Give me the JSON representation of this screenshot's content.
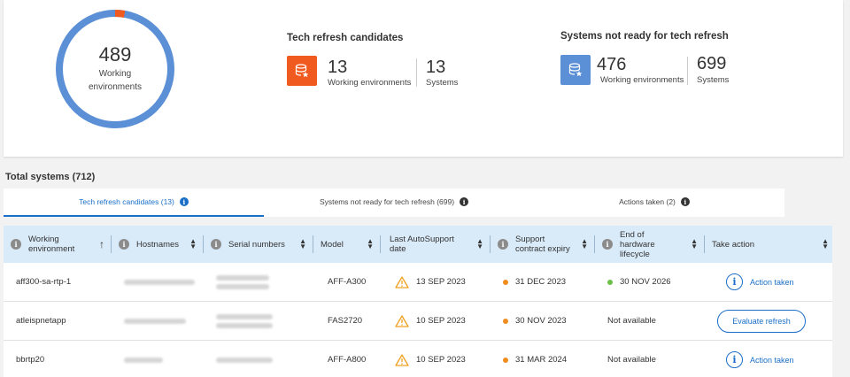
{
  "summary": {
    "total_working_envs": "489",
    "total_label_line1": "Working",
    "total_label_line2": "environments",
    "donut_fraction_candidates": 0.027,
    "candidates": {
      "title": "Tech refresh candidates",
      "we_count": "13",
      "we_label": "Working environments",
      "systems_count": "13",
      "systems_label": "Systems",
      "color": "#f15a1f"
    },
    "not_ready": {
      "title": "Systems not ready for tech refresh",
      "we_count": "476",
      "we_label": "Working environments",
      "systems_count": "699",
      "systems_label": "Systems",
      "color": "#5b8fd6"
    }
  },
  "total_systems_label": "Total systems (712)",
  "tabs": [
    {
      "label": "Tech refresh candidates (13)",
      "active": true
    },
    {
      "label": "Systems not ready for tech refresh (699)",
      "active": false
    },
    {
      "label": "Actions taken (2)",
      "active": false
    }
  ],
  "table": {
    "columns": [
      {
        "line1": "Working",
        "line2": "environment"
      },
      {
        "line1": "Hostnames",
        "line2": ""
      },
      {
        "line1": "Serial numbers",
        "line2": ""
      },
      {
        "line1": "Model",
        "line2": ""
      },
      {
        "line1": "Last AutoSupport",
        "line2": "date"
      },
      {
        "line1": "Support",
        "line2": "contract expiry"
      },
      {
        "line1": "End of",
        "line2": "hardware",
        "line3": "lifecycle"
      },
      {
        "line1": "Take action",
        "line2": ""
      }
    ],
    "rows": [
      {
        "we": "aff300-sa-rtp-1",
        "model": "AFF-A300",
        "asup": "13 SEP 2023",
        "contract": "31 DEC 2023",
        "eol": "30 NOV 2026",
        "eol_dot": true,
        "action": "Action taken",
        "action_type": "taken"
      },
      {
        "we": "atleispnetapp",
        "model": "FAS2720",
        "asup": "10 SEP 2023",
        "contract": "30 NOV 2023",
        "eol": "Not available",
        "eol_dot": false,
        "action": "Evaluate refresh",
        "action_type": "button"
      },
      {
        "we": "bbrtp20",
        "model": "AFF-A800",
        "asup": "10 SEP 2023",
        "contract": "31 MAR 2024",
        "eol": "Not available",
        "eol_dot": false,
        "action": "Action taken",
        "action_type": "taken"
      }
    ]
  },
  "colors": {
    "accent": "#1a6fc9",
    "donut_main": "#5b8fd6",
    "donut_candidates": "#f15a1f",
    "warning": "#f0a020",
    "contract_dot": "#f08c1e",
    "eol_dot": "#6cc04a",
    "header_bg": "#d9eaf8"
  }
}
